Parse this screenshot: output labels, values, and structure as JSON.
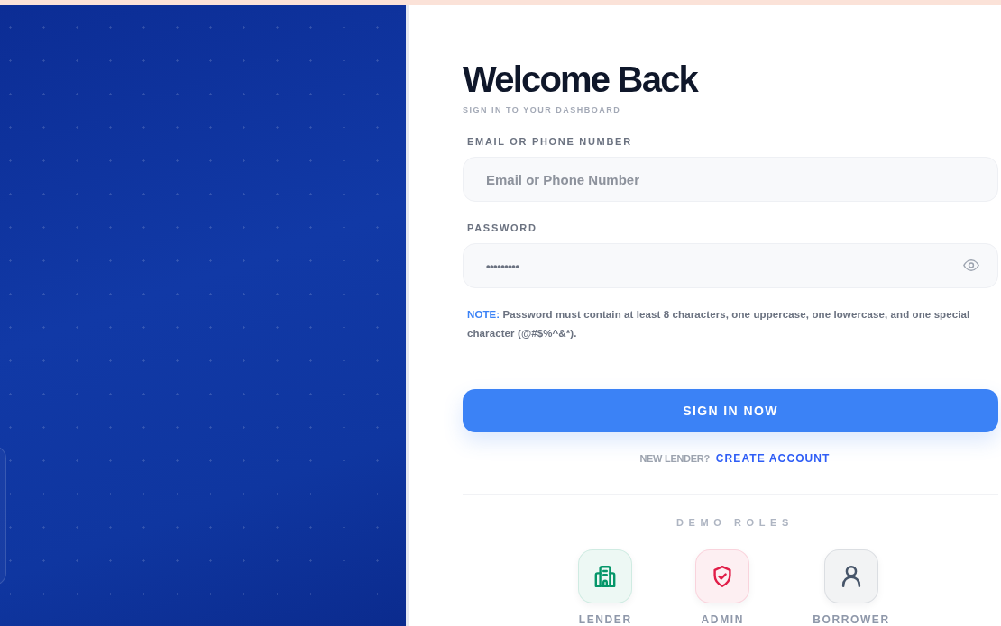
{
  "form": {
    "title": "Welcome Back",
    "subtitle": "SIGN IN TO YOUR DASHBOARD",
    "fields": [
      {
        "kind": "text",
        "label": "EMAIL OR PHONE NUMBER",
        "placeholder": "Email or Phone Number"
      },
      {
        "kind": "password",
        "label": "PASSWORD",
        "value": "•••••••••"
      }
    ],
    "note": {
      "label": "NOTE:",
      "text": "Password must contain at least 8 characters, one uppercase, one lowercase, and one special character (@#$%^&*)."
    },
    "submit_button": "SIGN IN NOW",
    "signup_prompt": {
      "text": "NEW LENDER?",
      "link": "CREATE ACCOUNT"
    },
    "demo_roles": {
      "title": "DEMO ROLES",
      "roles": [
        {
          "kind": "lender",
          "label": "LENDER",
          "color": "#059669"
        },
        {
          "kind": "admin",
          "label": "ADMIN",
          "color": "#e11d48"
        },
        {
          "kind": "borrower",
          "label": "BORROWER",
          "color": "#475569"
        }
      ]
    }
  }
}
